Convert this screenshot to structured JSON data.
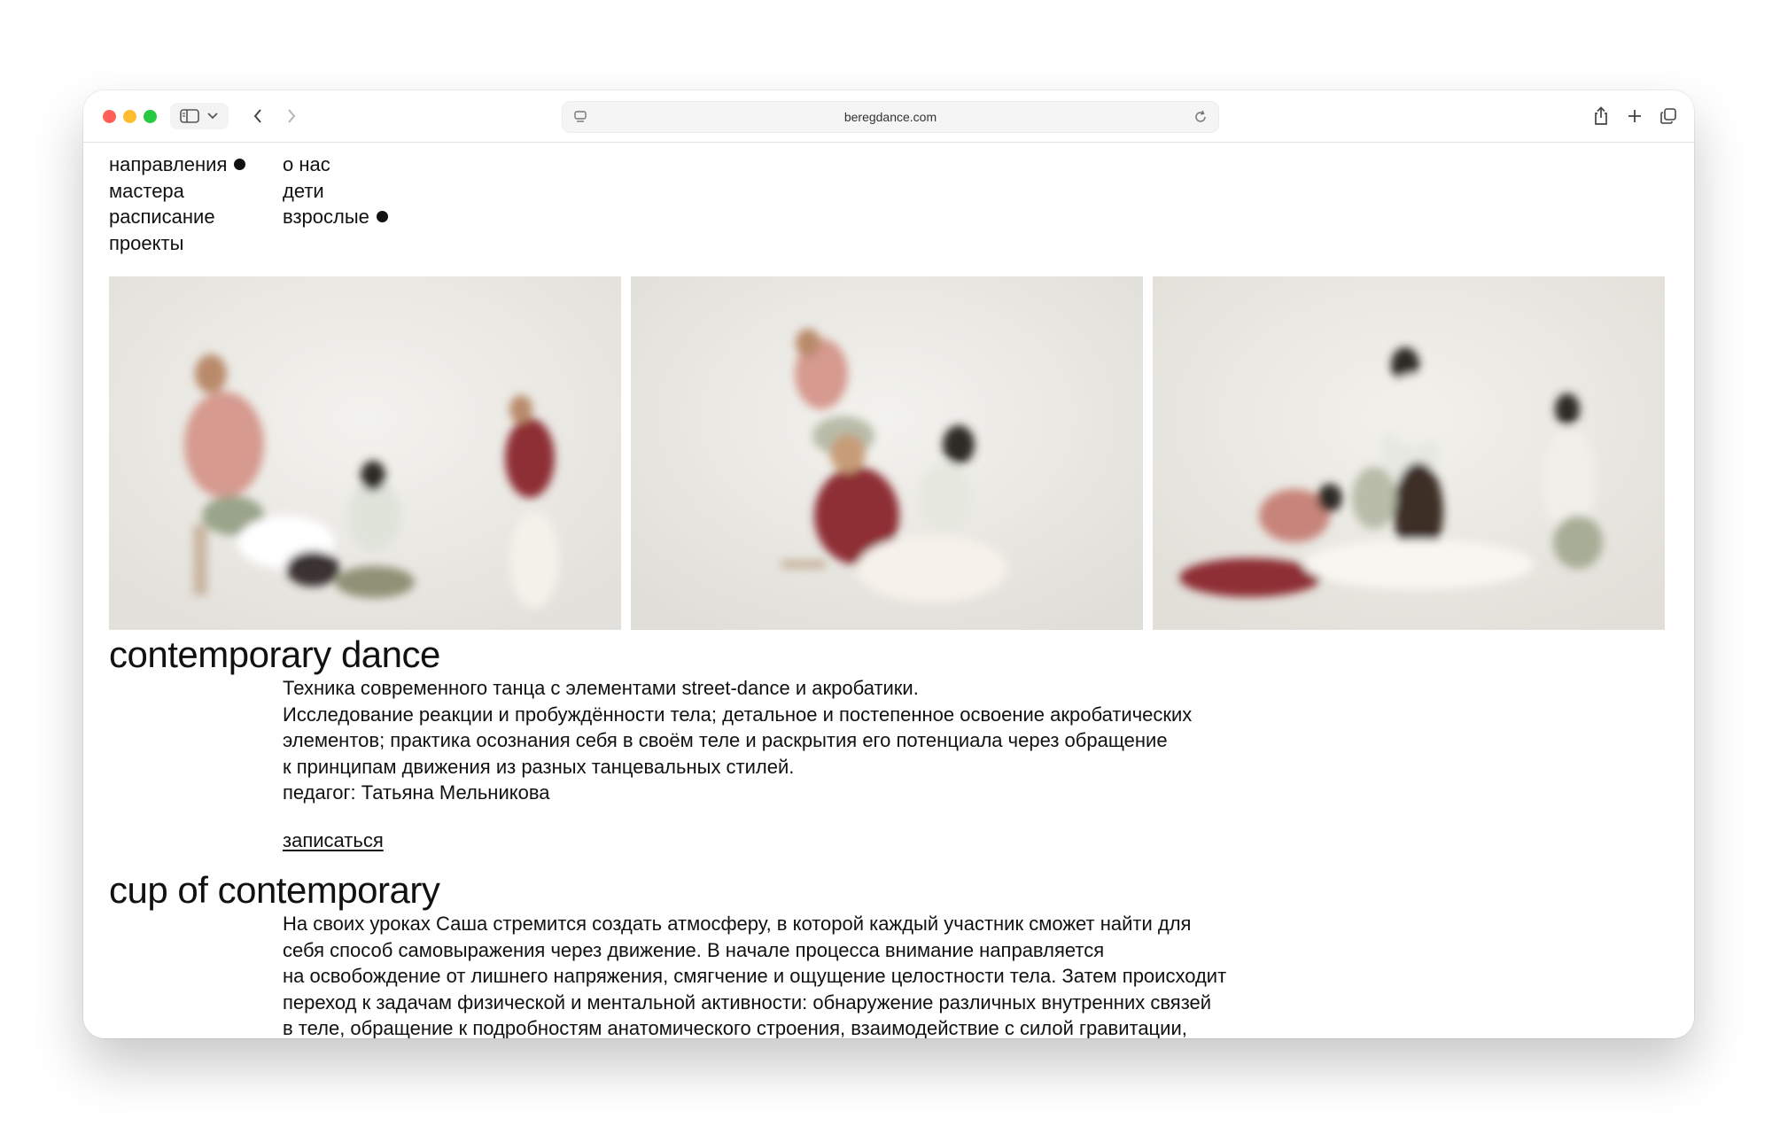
{
  "browser": {
    "url": "beregdance.com",
    "traffic_colors": {
      "close": "#ff5f57",
      "minimize": "#febc2e",
      "maximize": "#28c840"
    }
  },
  "nav": {
    "col1": [
      {
        "label": "направления",
        "active": true
      },
      {
        "label": "мастера",
        "active": false
      },
      {
        "label": "расписание",
        "active": false
      },
      {
        "label": "проекты",
        "active": false
      }
    ],
    "col2": [
      {
        "label": "о нас",
        "active": false
      },
      {
        "label": "дети",
        "active": false
      },
      {
        "label": "взрослые",
        "active": true
      }
    ]
  },
  "sections": [
    {
      "title": "contemporary dance",
      "lines": [
        "Техника современного танца с элементами street-dance и акробатики.",
        "Исследование реакции и пробуждённости тела; детальное и постепенное освоение акробатических",
        "элементов; практика осознания себя в своём теле и раскрытия его потенциала через обращение",
        "к принципам движения из разных танцевальных стилей.",
        "педагог: Татьяна Мельникова"
      ],
      "link": "записаться"
    },
    {
      "title": "cup of contemporary",
      "lines": [
        "На своих уроках Саша стремится создать атмосферу, в которой каждый участник сможет найти для",
        "себя способ самовыражения через движение. В начале процесса внимание направляется",
        "на освобождение от лишнего напряжения, смягчение и ощущение целостности тела. Затем происходит",
        "переход к задачам физической и ментальной активности: обнаружение различных внутренних связей",
        "в теле, обращение к подробностям анатомического строения, взаимодействие с силой гравитации,"
      ]
    }
  ],
  "colors": {
    "text": "#111111",
    "photo_bg": "#ecebe7",
    "accent_red": "#8e2e36",
    "accent_pink": "#d69a8f",
    "accent_sage": "#9aa48a"
  }
}
